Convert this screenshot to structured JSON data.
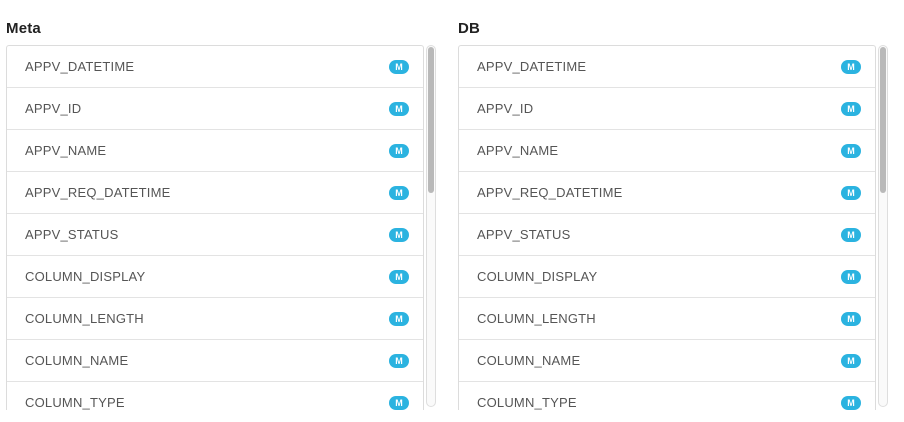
{
  "meta_panel": {
    "title": "Meta",
    "badge_label": "M",
    "items": [
      "APPV_DATETIME",
      "APPV_ID",
      "APPV_NAME",
      "APPV_REQ_DATETIME",
      "APPV_STATUS",
      "COLUMN_DISPLAY",
      "COLUMN_LENGTH",
      "COLUMN_NAME",
      "COLUMN_TYPE"
    ]
  },
  "db_panel": {
    "title": "DB",
    "badge_label": "M",
    "items": [
      "APPV_DATETIME",
      "APPV_ID",
      "APPV_NAME",
      "APPV_REQ_DATETIME",
      "APPV_STATUS",
      "COLUMN_DISPLAY",
      "COLUMN_LENGTH",
      "COLUMN_NAME",
      "COLUMN_TYPE"
    ]
  },
  "colors": {
    "badge": "#2bb3e0",
    "scroll_thumb": "#b9b9b9"
  },
  "icons": {
    "badge": "m-badge-icon"
  }
}
